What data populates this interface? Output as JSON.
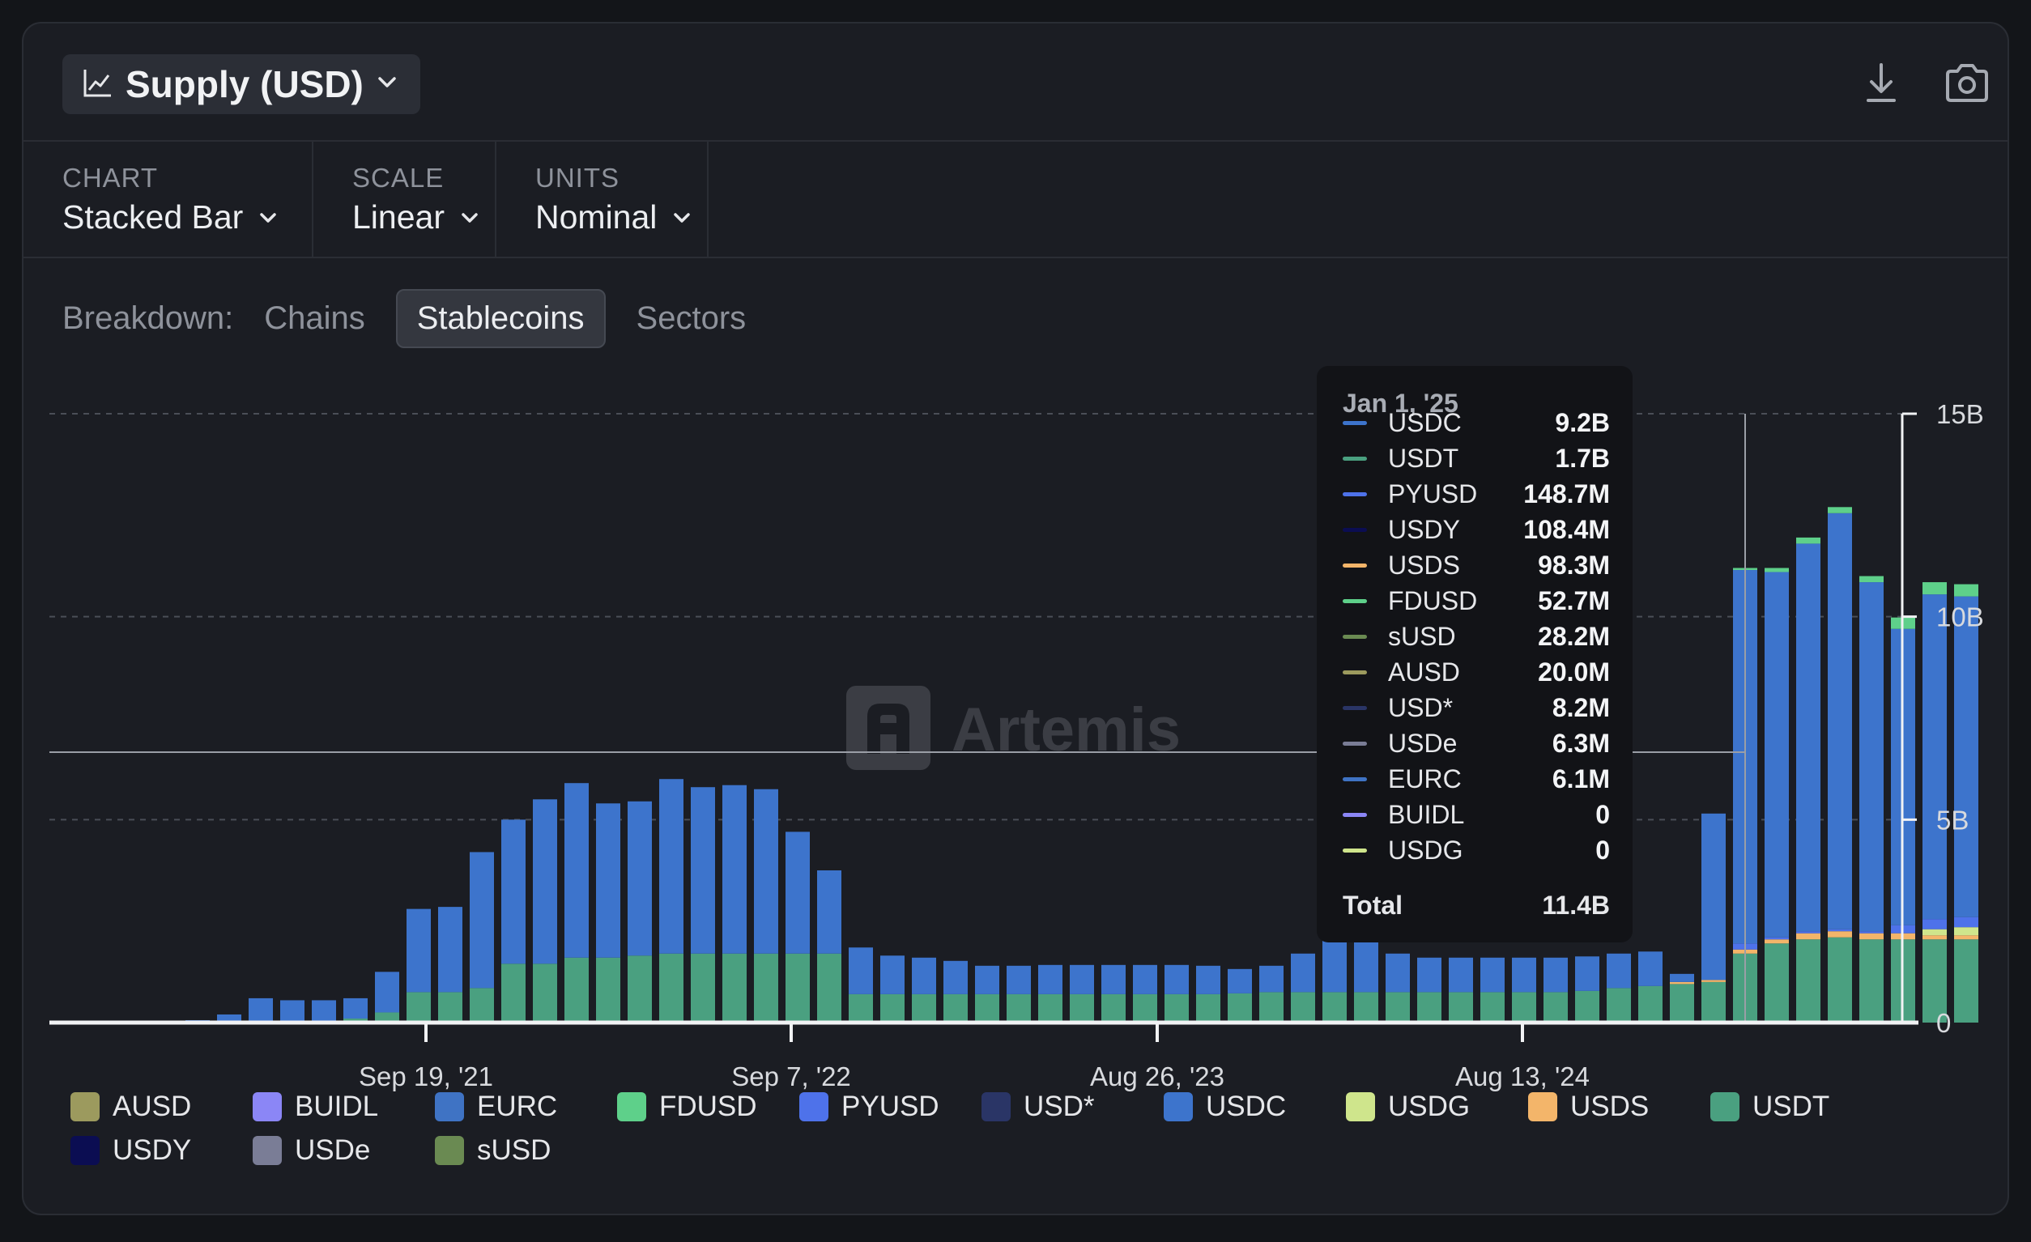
{
  "header": {
    "title": "Supply (USD)",
    "icons": [
      "line-chart-icon",
      "chevron-down-icon",
      "download-icon",
      "camera-icon"
    ]
  },
  "controls": [
    {
      "label": "CHART",
      "value": "Stacked Bar"
    },
    {
      "label": "SCALE",
      "value": "Linear"
    },
    {
      "label": "UNITS",
      "value": "Nominal"
    }
  ],
  "breakdown": {
    "label": "Breakdown:",
    "options": [
      "Chains",
      "Stablecoins",
      "Sectors"
    ],
    "selected": "Stablecoins"
  },
  "watermark": "Artemis",
  "colors": {
    "AUSD": "#9c9a5e",
    "BUIDL": "#8b86f6",
    "EURC": "#3f73c4",
    "FDUSD": "#5ed08a",
    "PYUSD": "#4e72ea",
    "USD*": "#2a3566",
    "USDC": "#3d74cc",
    "USDG": "#cfe58c",
    "USDS": "#f3b56a",
    "USDT": "#4aa080",
    "USDY": "#0b0d52",
    "USDe": "#7a7d96",
    "sUSD": "#6a8a52"
  },
  "chart_data": {
    "type": "bar",
    "stacked": true,
    "y_axis": {
      "ticks": [
        "0",
        "5B",
        "10B",
        "15B"
      ],
      "range": [
        0,
        15
      ],
      "unit": "B",
      "position": "right"
    },
    "x_axis": {
      "tick_labels": [
        "Sep 19, '21",
        "Sep 7, '22",
        "Aug 26, '23",
        "Aug 13, '24"
      ]
    },
    "grid": "dashed horizontal",
    "legend_position": "bottom",
    "series_order": [
      "USDT",
      "USDS",
      "USDG",
      "PYUSD",
      "USDC",
      "FDUSD"
    ],
    "bars": [
      {
        "USDT": 0,
        "USDC": 0.06
      },
      {
        "USDT": 0,
        "USDC": 0.2
      },
      {
        "USDT": 0.05,
        "USDC": 0.55
      },
      {
        "USDT": 0.05,
        "USDC": 0.5
      },
      {
        "USDT": 0.05,
        "USDC": 0.5
      },
      {
        "USDT": 0.1,
        "USDC": 0.5
      },
      {
        "USDT": 0.25,
        "USDC": 1.0
      },
      {
        "USDT": 0.75,
        "USDC": 2.05
      },
      {
        "USDT": 0.75,
        "USDC": 2.1
      },
      {
        "USDT": 0.85,
        "USDC": 3.35
      },
      {
        "USDT": 1.45,
        "USDC": 3.55
      },
      {
        "USDT": 1.45,
        "USDC": 4.05
      },
      {
        "USDT": 1.6,
        "USDC": 4.3
      },
      {
        "USDT": 1.6,
        "USDC": 3.8
      },
      {
        "USDT": 1.65,
        "USDC": 3.8
      },
      {
        "USDT": 1.7,
        "USDC": 4.3
      },
      {
        "USDT": 1.7,
        "USDC": 4.1
      },
      {
        "USDT": 1.7,
        "USDC": 4.15
      },
      {
        "USDT": 1.7,
        "USDC": 4.05
      },
      {
        "USDT": 1.7,
        "USDC": 3.0
      },
      {
        "USDT": 1.7,
        "USDC": 2.05
      },
      {
        "USDT": 0.7,
        "USDC": 1.15
      },
      {
        "USDT": 0.7,
        "USDC": 0.95
      },
      {
        "USDT": 0.7,
        "USDC": 0.9
      },
      {
        "USDT": 0.7,
        "USDC": 0.82
      },
      {
        "USDT": 0.7,
        "USDC": 0.7
      },
      {
        "USDT": 0.7,
        "USDC": 0.7
      },
      {
        "USDT": 0.7,
        "USDC": 0.72
      },
      {
        "USDT": 0.7,
        "USDC": 0.72
      },
      {
        "USDT": 0.7,
        "USDC": 0.72
      },
      {
        "USDT": 0.7,
        "USDC": 0.72
      },
      {
        "USDT": 0.7,
        "USDC": 0.72
      },
      {
        "USDT": 0.7,
        "USDC": 0.7
      },
      {
        "USDT": 0.72,
        "USDC": 0.6
      },
      {
        "USDT": 0.75,
        "USDC": 0.65
      },
      {
        "USDT": 0.75,
        "USDC": 0.95
      },
      {
        "USDT": 0.75,
        "USDC": 1.3
      },
      {
        "USDT": 0.75,
        "USDC": 1.5
      },
      {
        "USDT": 0.75,
        "USDC": 0.95
      },
      {
        "USDT": 0.75,
        "USDC": 0.85
      },
      {
        "USDT": 0.75,
        "USDC": 0.85
      },
      {
        "USDT": 0.75,
        "USDC": 0.85
      },
      {
        "USDT": 0.75,
        "USDC": 0.85
      },
      {
        "USDT": 0.75,
        "USDC": 0.85
      },
      {
        "USDT": 0.78,
        "USDC": 0.85
      },
      {
        "USDT": 0.85,
        "USDC": 0.85
      },
      {
        "USDT": 0.9,
        "USDC": 0.85
      },
      {
        "USDT": 0.95,
        "USDS": 0.05,
        "USDC": 0.2
      },
      {
        "USDT": 1.0,
        "USDS": 0.05,
        "USDC": 4.1
      },
      {
        "USDT": 1.7,
        "USDS": 0.1,
        "PYUSD": 0.15,
        "USDC": 9.2,
        "FDUSD": 0.05
      },
      {
        "USDT": 1.95,
        "USDS": 0.1,
        "PYUSD": 0.05,
        "USDC": 9.0,
        "FDUSD": 0.1
      },
      {
        "USDT": 2.05,
        "USDS": 0.15,
        "PYUSD": 0.05,
        "USDC": 9.55,
        "FDUSD": 0.15
      },
      {
        "USDT": 2.1,
        "USDS": 0.15,
        "PYUSD": 0.05,
        "USDC": 10.25,
        "FDUSD": 0.15
      },
      {
        "USDT": 2.05,
        "USDS": 0.15,
        "PYUSD": 0.05,
        "USDC": 8.6,
        "FDUSD": 0.15
      },
      {
        "USDT": 2.05,
        "USDS": 0.15,
        "PYUSD": 0.2,
        "USDC": 7.3,
        "FDUSD": 0.28
      },
      {
        "USDT": 2.05,
        "USDS": 0.1,
        "USDG": 0.15,
        "PYUSD": 0.25,
        "USDC": 8.0,
        "FDUSD": 0.3
      },
      {
        "USDT": 2.05,
        "USDS": 0.1,
        "USDG": 0.2,
        "PYUSD": 0.25,
        "USDC": 7.9,
        "FDUSD": 0.3
      }
    ],
    "hover_index": 49
  },
  "tooltip": {
    "date": "Jan 1, '25",
    "rows": [
      {
        "name": "USDC",
        "value": "9.2B"
      },
      {
        "name": "USDT",
        "value": "1.7B"
      },
      {
        "name": "PYUSD",
        "value": "148.7M"
      },
      {
        "name": "USDY",
        "value": "108.4M"
      },
      {
        "name": "USDS",
        "value": "98.3M"
      },
      {
        "name": "FDUSD",
        "value": "52.7M"
      },
      {
        "name": "sUSD",
        "value": "28.2M"
      },
      {
        "name": "AUSD",
        "value": "20.0M"
      },
      {
        "name": "USD*",
        "value": "8.2M"
      },
      {
        "name": "USDe",
        "value": "6.3M"
      },
      {
        "name": "EURC",
        "value": "6.1M"
      },
      {
        "name": "BUIDL",
        "value": "0"
      },
      {
        "name": "USDG",
        "value": "0"
      }
    ],
    "total_label": "Total",
    "total_value": "11.4B"
  },
  "legend": [
    "AUSD",
    "BUIDL",
    "EURC",
    "FDUSD",
    "PYUSD",
    "USD*",
    "USDC",
    "USDG",
    "USDS",
    "USDT",
    "USDY",
    "USDe",
    "sUSD"
  ]
}
